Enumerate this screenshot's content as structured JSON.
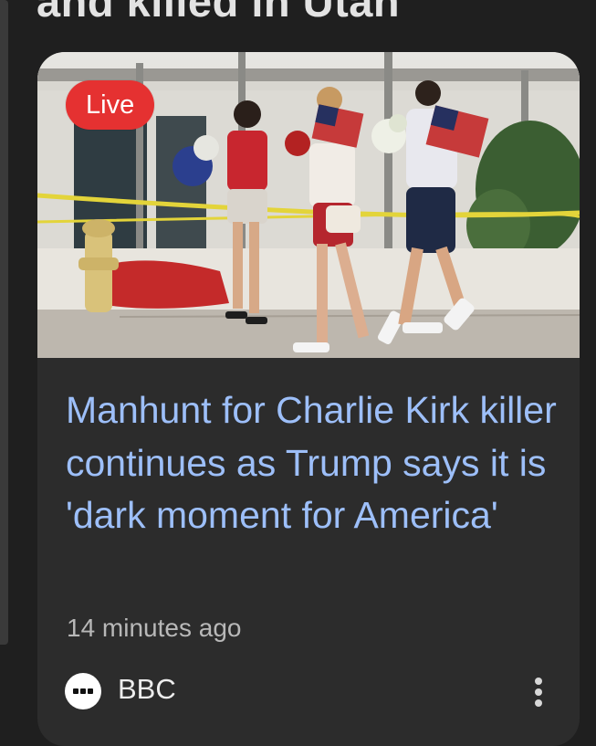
{
  "previous_story": {
    "title_fragment": "and killed in Utah"
  },
  "story": {
    "badge": "Live",
    "headline": "Manhunt for Charlie Kirk killer continues as Trump says it is 'dark moment for America'",
    "timestamp": "14 minutes ago",
    "source": {
      "name": "BBC",
      "logo_icon": "bbc-logo-icon"
    },
    "more_icon": "more-vert-icon",
    "image_description_icon": "news-photo"
  },
  "colors": {
    "background": "#1f1f1f",
    "card": "#2c2c2c",
    "headline": "#9dbff9",
    "badge": "#e53131",
    "timestamp": "#b8b8b8"
  }
}
